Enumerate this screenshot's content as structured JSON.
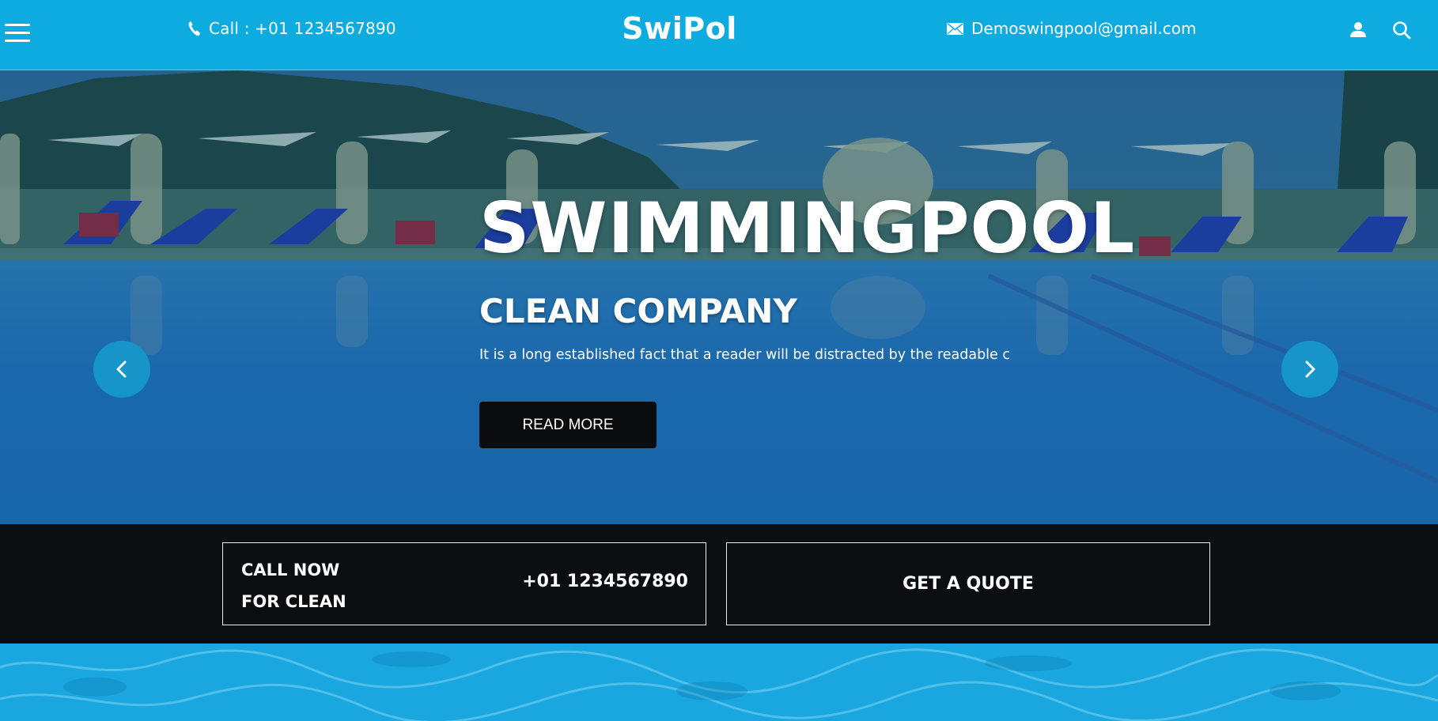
{
  "header": {
    "menu_icon": "hamburger-menu-icon",
    "phone_text": "Call : +01 1234567890",
    "logo": "SwiPol",
    "email_text": "Demoswingpool@gmail.com",
    "user_icon": "user-icon",
    "search_icon": "search-icon",
    "bg_color": "#0dabdf"
  },
  "hero": {
    "title": "SWIMMINGPOOL",
    "subtitle": "CLEAN COMPANY",
    "description": "It is a long established fact that a reader will be distracted by the readable c",
    "button_label": "READ MORE",
    "prev_icon": "chevron-left-icon",
    "next_icon": "chevron-right-icon",
    "arrow_color": "#1595c8"
  },
  "cta": {
    "call_line1": "CALL NOW",
    "call_line2": "FOR CLEAN",
    "call_number": "+01 1234567890",
    "quote_label": "GET A QUOTE",
    "bg_color": "#0b0e10"
  }
}
